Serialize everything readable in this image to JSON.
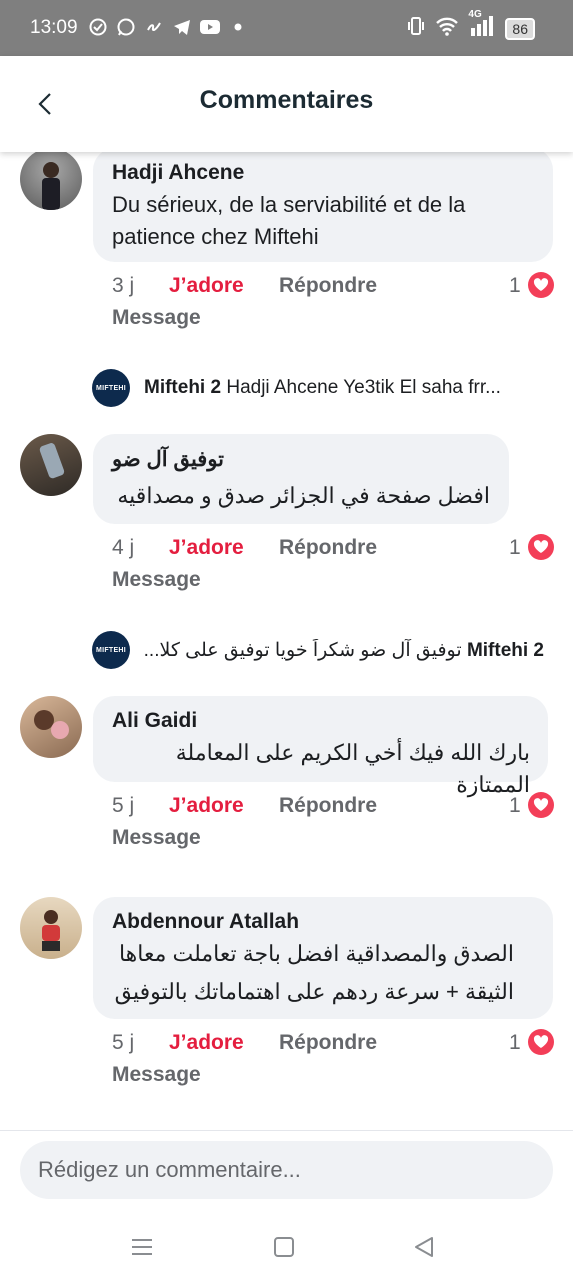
{
  "status": {
    "time": "13:09",
    "network": "4G",
    "battery": "86",
    "icons": [
      "circle-check-icon",
      "whatsapp-icon",
      "link-icon",
      "telegram-icon",
      "youtube-icon",
      "dot-icon"
    ],
    "right_icons": [
      "vibrate-icon",
      "wifi-icon",
      "signal-icon",
      "battery-icon"
    ]
  },
  "header": {
    "title": "Commentaires"
  },
  "comments": [
    {
      "author": "Hadji Ahcene",
      "text_lines": [
        "Du sérieux, de la serviabilité et de la",
        "patience chez Miftehi"
      ],
      "time": "3 j",
      "like": "J’adore",
      "reply": "Répondre",
      "reactions": "1",
      "message": "Message"
    },
    {
      "author": "توفيق آل ضو",
      "text_lines": [
        "افضل صفحة في الجزائر صدق و مصداقيه"
      ],
      "time": "4 j",
      "like": "J’adore",
      "reply": "Répondre",
      "reactions": "1",
      "message": "Message"
    },
    {
      "author": "Ali Gaidi",
      "text_lines": [
        "بارك الله فيك أخي الكريم على المعاملة الممتازة"
      ],
      "time": "5 j",
      "like": "J’adore",
      "reply": "Répondre",
      "reactions": "1",
      "message": "Message"
    },
    {
      "author": "Abdennour Atallah",
      "text_lines": [
        "الصدق والمصداقية  افضل باجة تعاملت معاها",
        "الثيقة + سرعة ردهم على اهتماماتك بالتوفيق"
      ],
      "time": "5 j",
      "like": "J’adore",
      "reply": "Répondre",
      "reactions": "1",
      "message": "Message"
    }
  ],
  "replies": [
    {
      "author": "Miftehi 2",
      "text": "Hadji Ahcene Ye3tik El saha frr...",
      "avatar_label": "MIFTEHI"
    },
    {
      "author": "Miftehi 2",
      "text": "توفيق آل ضو شكراً خويا توفيق على كلا...",
      "avatar_label": "MIFTEHI"
    }
  ],
  "composer": {
    "placeholder": "Rédigez un commentaire..."
  },
  "navbar": [
    "menu-icon",
    "home-square-icon",
    "back-triangle-icon"
  ]
}
